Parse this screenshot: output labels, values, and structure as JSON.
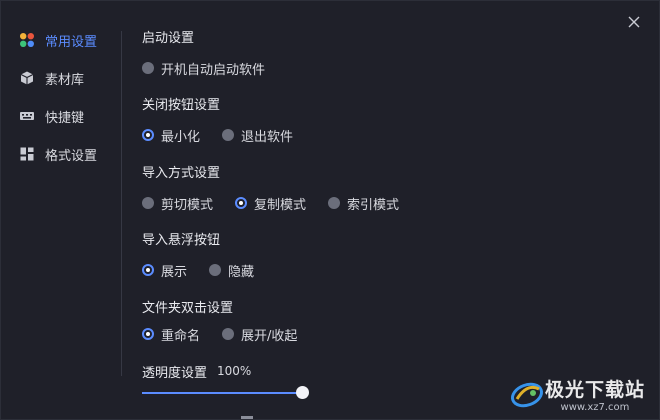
{
  "sidebar": {
    "items": [
      {
        "label": "常用设置",
        "icon": "app-grid-color-icon",
        "active": true
      },
      {
        "label": "素材库",
        "icon": "cube-icon",
        "active": false
      },
      {
        "label": "快捷键",
        "icon": "keyboard-icon",
        "active": false
      },
      {
        "label": "格式设置",
        "icon": "tiles-icon",
        "active": false
      }
    ]
  },
  "settings": {
    "startup": {
      "title": "启动设置",
      "options": [
        {
          "label": "开机自动启动软件",
          "checked": false
        }
      ]
    },
    "close_button": {
      "title": "关闭按钮设置",
      "options": [
        {
          "label": "最小化",
          "checked": true
        },
        {
          "label": "退出软件",
          "checked": false
        }
      ]
    },
    "import_mode": {
      "title": "导入方式设置",
      "options": [
        {
          "label": "剪切模式",
          "checked": false
        },
        {
          "label": "复制模式",
          "checked": true
        },
        {
          "label": "索引模式",
          "checked": false
        }
      ]
    },
    "float_button": {
      "title": "导入悬浮按钮",
      "options": [
        {
          "label": "展示",
          "checked": true
        },
        {
          "label": "隐藏",
          "checked": false
        }
      ]
    },
    "folder_dblclick": {
      "title": "文件夹双击设置",
      "options": [
        {
          "label": "重命名",
          "checked": true
        },
        {
          "label": "展开/收起",
          "checked": false
        }
      ]
    },
    "opacity": {
      "title": "透明度设置",
      "value_text": "100%",
      "value": 1.0
    }
  },
  "watermark": {
    "title": "极光下载站",
    "url": "www.xz7.com"
  },
  "colors": {
    "accent": "#5b8cff",
    "background": "#1f2029",
    "radio_off": "#6b6e7b"
  }
}
